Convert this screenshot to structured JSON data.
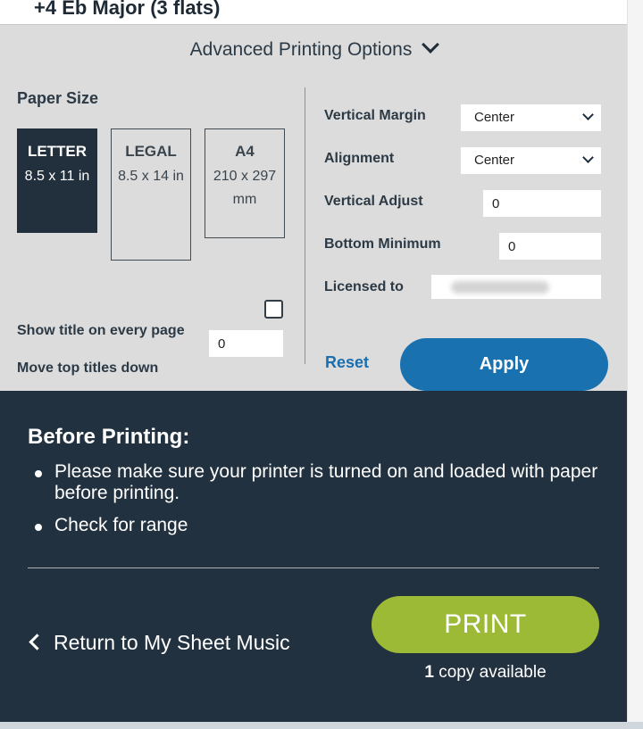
{
  "header": {
    "key_title": "+4 Eb Major (3 flats)"
  },
  "advanced": {
    "toggle_label": "Advanced Printing Options",
    "paper_size_label": "Paper Size",
    "papers": [
      {
        "name": "LETTER",
        "dims": "8.5 x 11 in",
        "selected": true
      },
      {
        "name": "LEGAL",
        "dims": "8.5 x 14 in",
        "selected": false
      },
      {
        "name": "A4",
        "dims": "210 x 297 mm",
        "selected": false
      }
    ],
    "show_title_label": "Show title on every page",
    "show_title_checked": false,
    "move_titles_label": "Move top titles down",
    "move_titles_value": "0",
    "vertical_margin_label": "Vertical Margin",
    "vertical_margin_value": "Center",
    "alignment_label": "Alignment",
    "alignment_value": "Center",
    "vertical_adjust_label": "Vertical Adjust",
    "vertical_adjust_value": "0",
    "bottom_minimum_label": "Bottom Minimum",
    "bottom_minimum_value": "0",
    "licensed_to_label": "Licensed to",
    "reset_label": "Reset",
    "apply_label": "Apply"
  },
  "before_printing": {
    "title": "Before Printing:",
    "bullets": [
      "Please make sure your printer is turned on and loaded with paper before printing.",
      "Check for range"
    ],
    "return_label": "Return to My Sheet Music",
    "print_label": "PRINT",
    "copies_count": "1",
    "copies_text": "copy available"
  },
  "colors": {
    "dark_panel": "#22313f",
    "print_green": "#9cba36",
    "apply_blue": "#1a71b0",
    "options_bg": "#dcdcdc"
  }
}
